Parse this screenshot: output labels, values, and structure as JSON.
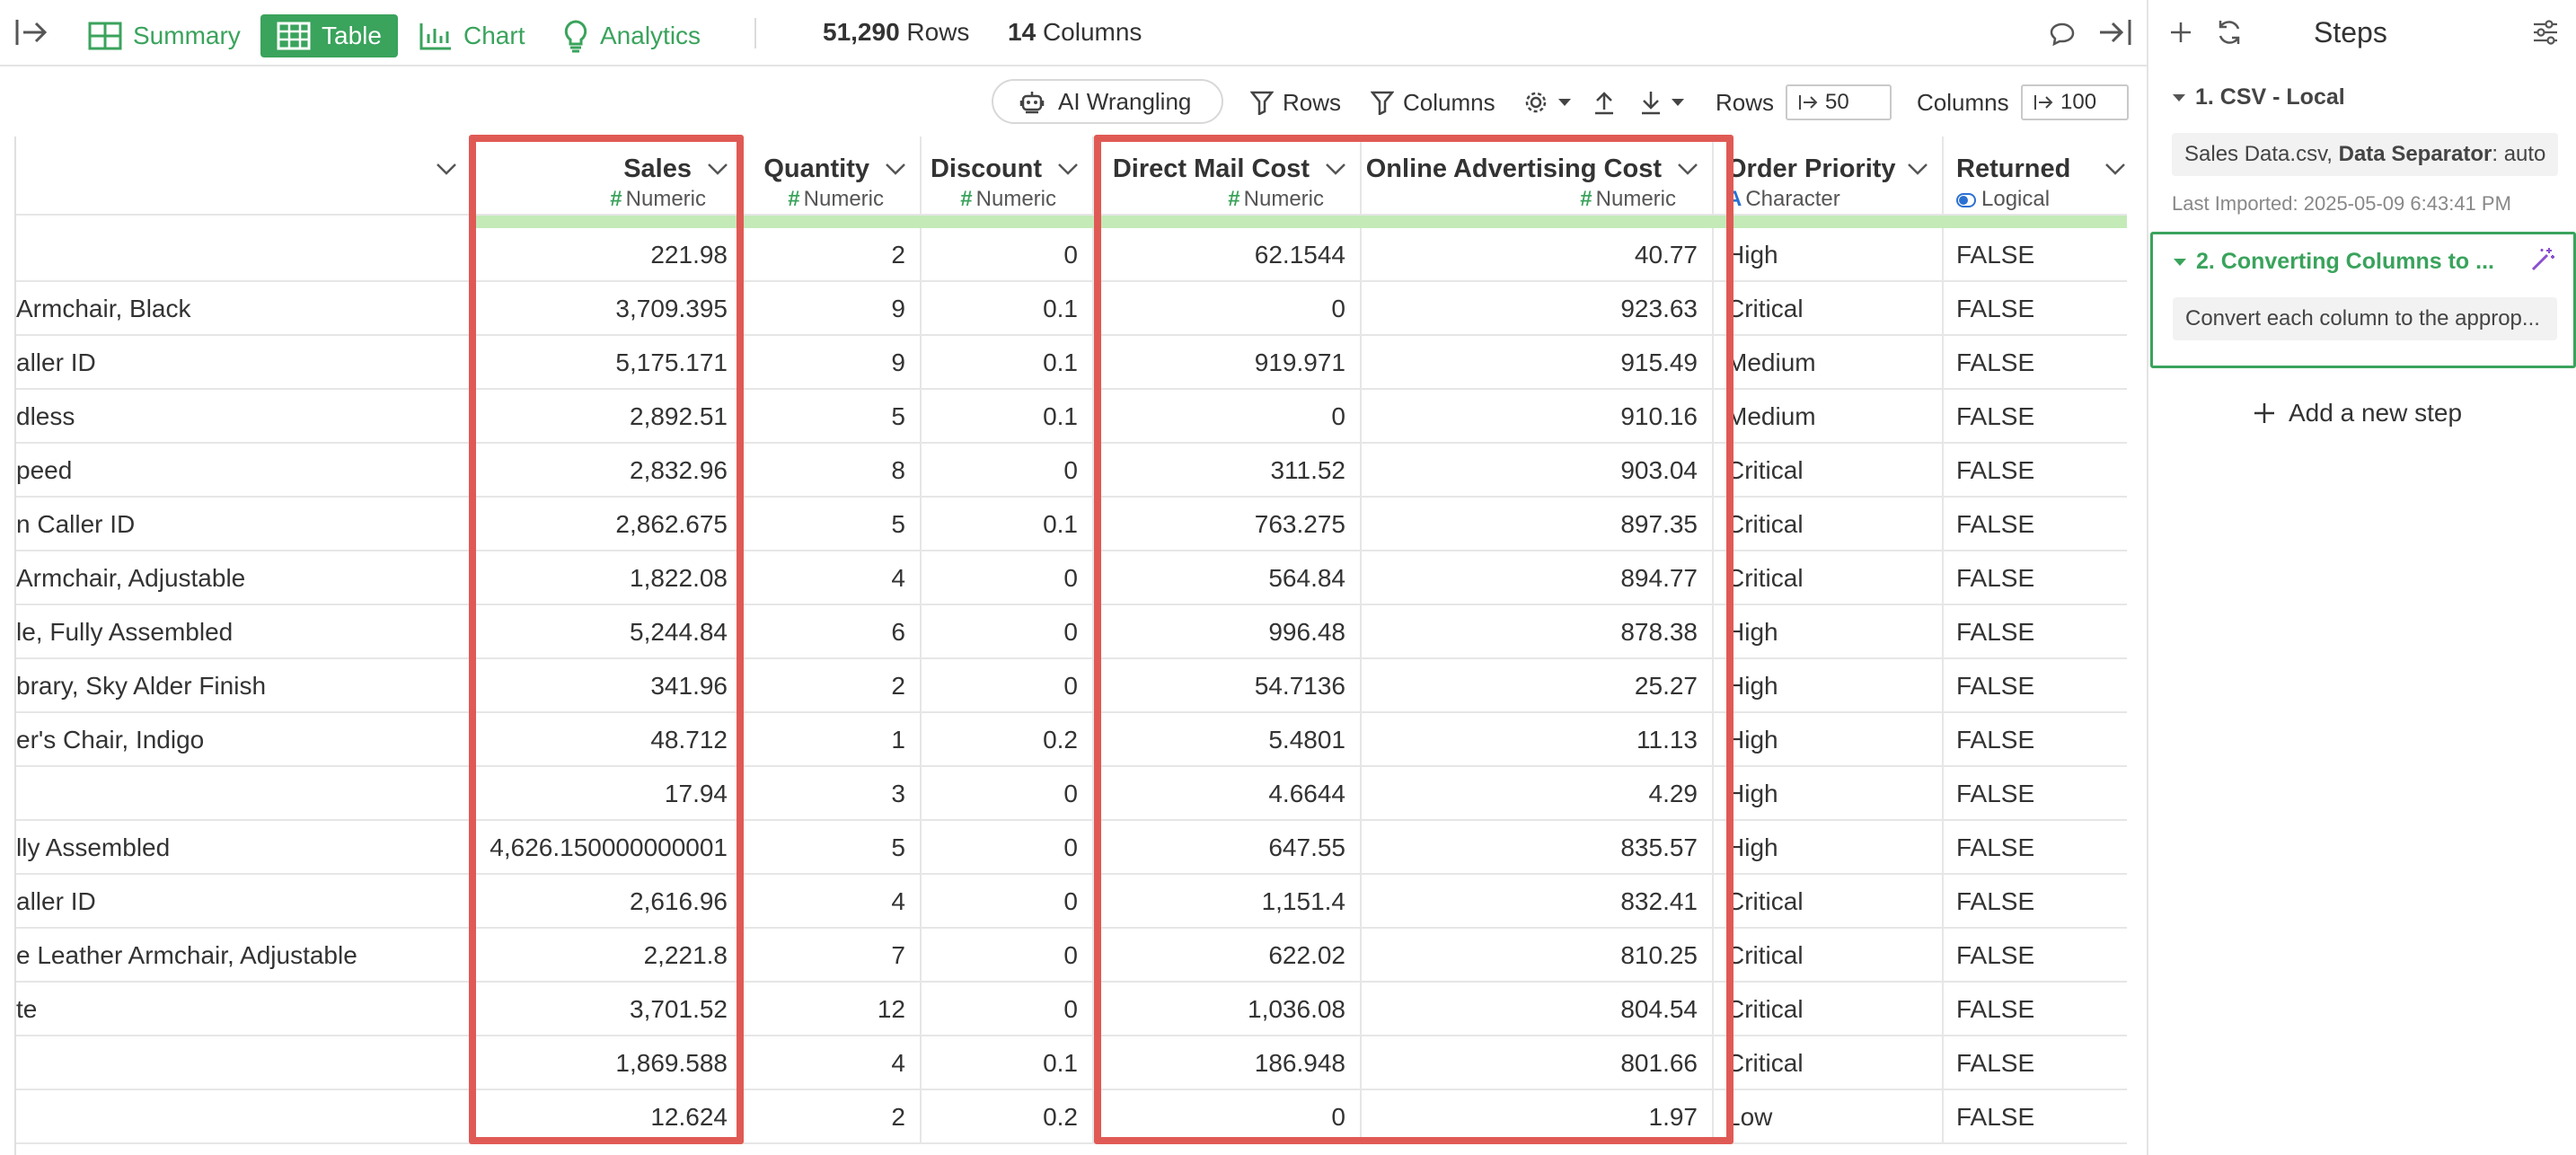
{
  "toolbar": {
    "tabs": [
      {
        "label": "Summary",
        "icon": "summary-icon"
      },
      {
        "label": "Table",
        "icon": "table-icon",
        "active": true
      },
      {
        "label": "Chart",
        "icon": "chart-icon"
      },
      {
        "label": "Analytics",
        "icon": "analytics-icon"
      }
    ],
    "rows_count": "51,290",
    "rows_label": "Rows",
    "columns_count": "14",
    "columns_label": "Columns"
  },
  "toolbar2": {
    "ai_wrangling": "AI Wrangling",
    "rows_filter": "Rows",
    "columns_filter": "Columns",
    "rows_label": "Rows",
    "rows_value": "50",
    "columns_label": "Columns",
    "columns_value": "100"
  },
  "table": {
    "columns": [
      {
        "name": "",
        "type": "",
        "type_icon": ""
      },
      {
        "name": "Sales",
        "type": "Numeric",
        "type_icon": "#"
      },
      {
        "name": "Quantity",
        "type": "Numeric",
        "type_icon": "#"
      },
      {
        "name": "Discount",
        "type": "Numeric",
        "type_icon": "#"
      },
      {
        "name": "Direct Mail Cost",
        "type": "Numeric",
        "type_icon": "#"
      },
      {
        "name": "Online Advertising Cost",
        "type": "Numeric",
        "type_icon": "#"
      },
      {
        "name": "Order Priority",
        "type": "Character",
        "type_icon": "A"
      },
      {
        "name": "Returned",
        "type": "Logical",
        "type_icon": "toggle"
      }
    ],
    "rows": [
      [
        "",
        "221.98",
        "2",
        "0",
        "62.1544",
        "40.77",
        "High",
        "FALSE"
      ],
      [
        "Armchair, Black",
        "3,709.395",
        "9",
        "0.1",
        "0",
        "923.63",
        "Critical",
        "FALSE"
      ],
      [
        "aller ID",
        "5,175.171",
        "9",
        "0.1",
        "919.971",
        "915.49",
        "Medium",
        "FALSE"
      ],
      [
        "dless",
        "2,892.51",
        "5",
        "0.1",
        "0",
        "910.16",
        "Medium",
        "FALSE"
      ],
      [
        "peed",
        "2,832.96",
        "8",
        "0",
        "311.52",
        "903.04",
        "Critical",
        "FALSE"
      ],
      [
        "n Caller ID",
        "2,862.675",
        "5",
        "0.1",
        "763.275",
        "897.35",
        "Critical",
        "FALSE"
      ],
      [
        "Armchair, Adjustable",
        "1,822.08",
        "4",
        "0",
        "564.84",
        "894.77",
        "Critical",
        "FALSE"
      ],
      [
        "le, Fully Assembled",
        "5,244.84",
        "6",
        "0",
        "996.48",
        "878.38",
        "High",
        "FALSE"
      ],
      [
        "brary, Sky Alder Finish",
        "341.96",
        "2",
        "0",
        "54.7136",
        "25.27",
        "High",
        "FALSE"
      ],
      [
        "er's Chair, Indigo",
        "48.712",
        "1",
        "0.2",
        "5.4801",
        "11.13",
        "High",
        "FALSE"
      ],
      [
        "",
        "17.94",
        "3",
        "0",
        "4.6644",
        "4.29",
        "High",
        "FALSE"
      ],
      [
        "lly Assembled",
        "4,626.150000000001",
        "5",
        "0",
        "647.55",
        "835.57",
        "High",
        "FALSE"
      ],
      [
        "aller ID",
        "2,616.96",
        "4",
        "0",
        "1,151.4",
        "832.41",
        "Critical",
        "FALSE"
      ],
      [
        "e Leather Armchair, Adjustable",
        "2,221.8",
        "7",
        "0",
        "622.02",
        "810.25",
        "Critical",
        "FALSE"
      ],
      [
        "te",
        "3,701.52",
        "12",
        "0",
        "1,036.08",
        "804.54",
        "Critical",
        "FALSE"
      ],
      [
        "",
        "1,869.588",
        "4",
        "0.1",
        "186.948",
        "801.66",
        "Critical",
        "FALSE"
      ],
      [
        "",
        "12.624",
        "2",
        "0.2",
        "0",
        "1.97",
        "Low",
        "FALSE"
      ]
    ]
  },
  "panel": {
    "title": "Steps",
    "step1_title": "1. CSV - Local",
    "step1_file": "Sales Data.csv,",
    "step1_sep_label": "Data Separator",
    "step1_sep_value": ": auto",
    "step1_meta": "Last Imported: 2025-05-09 6:43:41 PM",
    "step2_title": "2. Converting Columns to ...",
    "step2_desc": "Convert each column to the approp...",
    "add_step": "Add a new step"
  },
  "colors": {
    "accent_green": "#3aa35c",
    "highlight_red": "#e05a55",
    "histogram_green": "#c4eab8"
  }
}
